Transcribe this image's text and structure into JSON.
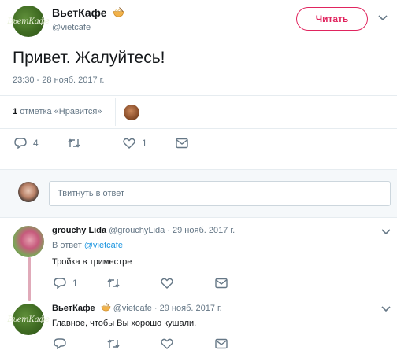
{
  "tweet": {
    "display_name": "ВьетКафе",
    "handle": "@vietcafe",
    "avatar_text": "ВьетКафе",
    "follow_label": "Читать",
    "text": "Привет. Жалуйтесь!",
    "timestamp": "23:30 - 28 нояб. 2017 г.",
    "likes_count": "1",
    "likes_label": "отметка «Нравится»",
    "reply_count": "4",
    "like_count": "1"
  },
  "reply_input": {
    "placeholder": "Твитнуть в ответ"
  },
  "replies": [
    {
      "display_name": "grouchy Lida",
      "handle": "@grouchyLida",
      "date": "· 29 нояб. 2017 г.",
      "in_reply_prefix": "В ответ",
      "in_reply_handle": "@vietcafe",
      "text": "Тройка в триместре",
      "reply_count": "1"
    },
    {
      "display_name": "ВьетКафе",
      "handle": "@vietcafe",
      "date": "· 29 нояб. 2017 г.",
      "avatar_text": "ВьетКафе",
      "text": "Главное, чтобы Вы хорошо кушали."
    }
  ],
  "colors": {
    "accent_pink": "#e0245e",
    "link_blue": "#1b95e0",
    "muted_gray": "#657786",
    "avatar_green": "#4a7a2c"
  }
}
